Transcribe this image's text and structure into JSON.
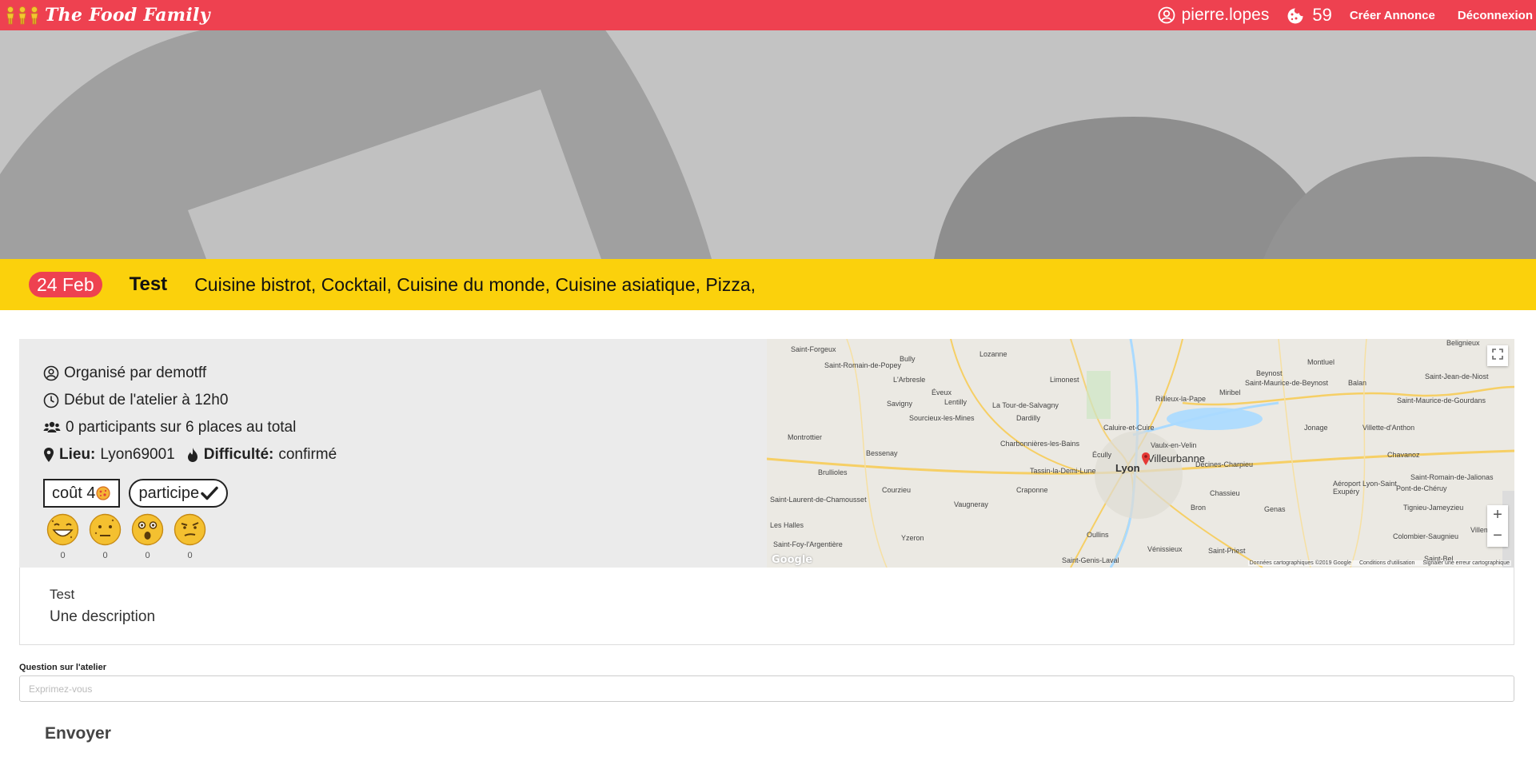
{
  "nav": {
    "brand": "The Food Family",
    "username": "pierre.lopes",
    "cookie_count": "59",
    "create_label": "Créer Annonce",
    "logout_label": "Déconnexion"
  },
  "event": {
    "date": "24 Feb",
    "title": "Test",
    "tags": "Cuisine bistrot, Cocktail, Cuisine du monde, Cuisine asiatique, Pizza,",
    "organizer": "Organisé par demotff",
    "start": "Début de l'atelier à 12h0",
    "participants": "0 participants sur 6 places au total",
    "place_label": "Lieu:",
    "place_value": "Lyon69001",
    "difficulty_label": "Difficulté:",
    "difficulty_value": "confirmé",
    "cost_label": "coût 4",
    "participate_label": "participe",
    "reactions": [
      {
        "icon": "laughing-cookie-icon",
        "count": "0"
      },
      {
        "icon": "neutral-cookie-icon",
        "count": "0"
      },
      {
        "icon": "surprised-cookie-icon",
        "count": "0"
      },
      {
        "icon": "skeptical-cookie-icon",
        "count": "0"
      }
    ]
  },
  "map": {
    "labels": [
      "Saint-Forgeux",
      "Saint-Romain-de-Popey",
      "Bully",
      "Lozanne",
      "L'Arbresle",
      "Éveux",
      "Limonest",
      "Rillieux-la-Pape",
      "Beynost",
      "Montluel",
      "Balan",
      "Saint-Jean-de-Niost",
      "Savigny",
      "Lentilly",
      "La Tour-de-Salvagny",
      "Sourcieux-les-Mines",
      "Dardilly",
      "Caluire-et-Cuire",
      "Vaulx-en-Velin",
      "Miribel",
      "Jonage",
      "Villette-d'Anthon",
      "Saint-Maurice-de-Beynost",
      "Saint-Maurice-de-Gourdans",
      "Montrottier",
      "Bessenay",
      "Charbonnières-les-Bains",
      "Écully",
      "Tassin-la-Demi-Lune",
      "Décines-Charpieu",
      "Chavanoz",
      "Brullioles",
      "Courzieu",
      "Craponne",
      "Chassieu",
      "Aéroport Lyon-Saint Exupéry",
      "Pont-de-Chéruy",
      "Saint-Romain-de-Jalionas",
      "Saint-Laurent-de-Chamousset",
      "Vaugneray",
      "Bron",
      "Genas",
      "Tignieu-Jameyzieu",
      "Yzeron",
      "Oullins",
      "Vénissieux",
      "Saint-Priest",
      "Colombier-Saugnieu",
      "Villemoi",
      "Saint-Foy-l'Argentière",
      "Saint-Genis-Laval",
      "Saint-Bel",
      "Belignieux",
      "Les Halles"
    ],
    "cities": [
      "Lyon",
      "Villeurbanne"
    ],
    "attrib_data": "Données cartographiques ©2019 Google",
    "attrib_terms": "Conditions d'utilisation",
    "attrib_report": "Signaler une erreur cartographique",
    "google": "Google",
    "zoom_in": "+",
    "zoom_out": "−"
  },
  "description": {
    "title": "Test",
    "text": "Une description"
  },
  "question": {
    "label": "Question sur l'atelier",
    "placeholder": "Exprimez-vous",
    "send_label": "Envoyer"
  },
  "colors": {
    "brand_red": "#ee4150",
    "accent_yellow": "#fbd10c",
    "banner_gray": "#c3c3c3"
  }
}
